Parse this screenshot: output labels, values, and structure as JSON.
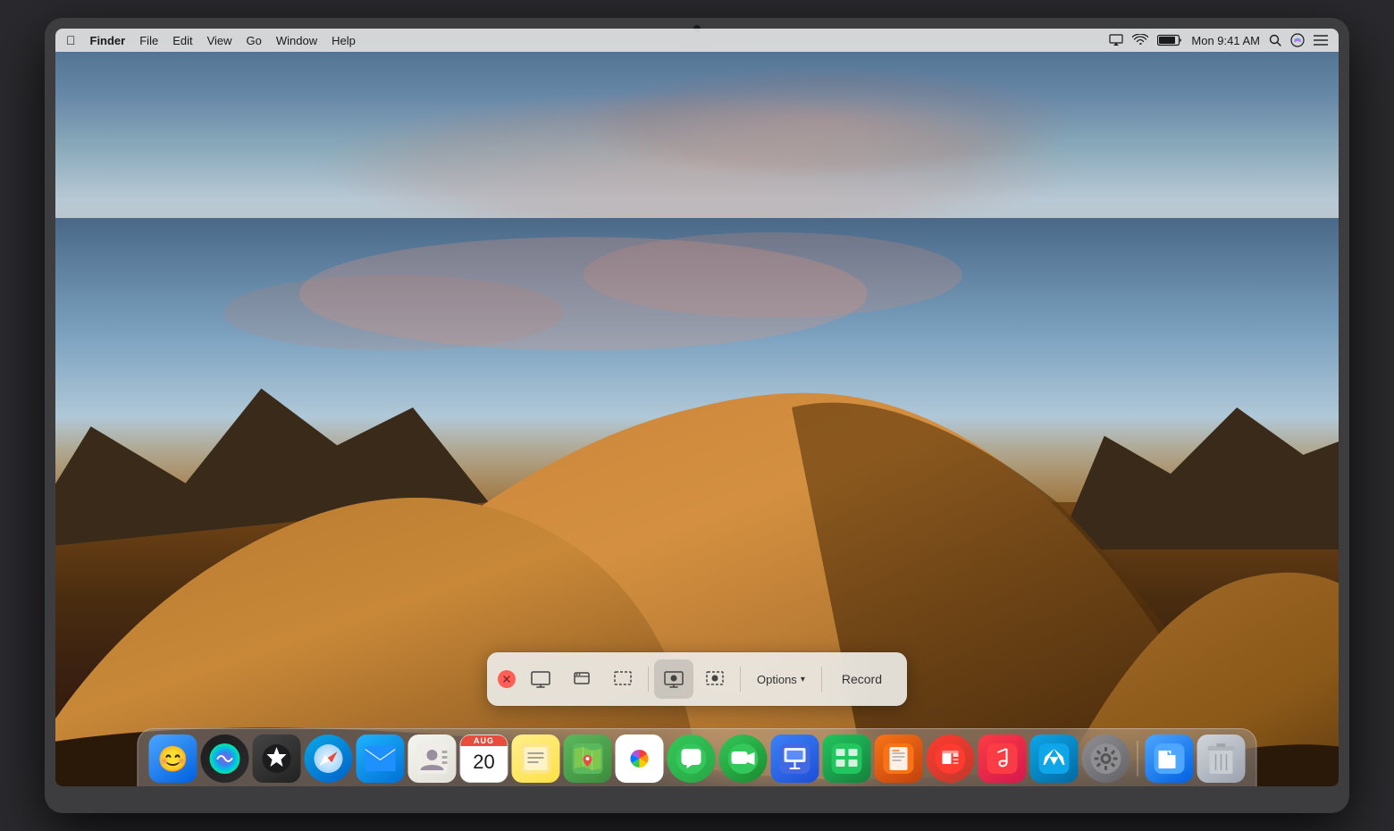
{
  "laptop": {
    "frame_color": "#3d3d3f"
  },
  "menubar": {
    "apple_symbol": "🍎",
    "finder_label": "Finder",
    "menu_items": [
      "File",
      "Edit",
      "View",
      "Go",
      "Window",
      "Help"
    ],
    "time": "Mon 9:41 AM",
    "battery_icon": "battery",
    "wifi_icon": "wifi",
    "airplay_icon": "airplay",
    "search_icon": "search",
    "siri_icon": "siri",
    "list_icon": "list"
  },
  "screenshot_toolbar": {
    "close_label": "×",
    "options_label": "Options",
    "options_chevron": "▾",
    "record_label": "Record",
    "buttons": [
      {
        "id": "capture-fullscreen",
        "tooltip": "Capture Entire Screen"
      },
      {
        "id": "capture-window",
        "tooltip": "Capture Selected Window"
      },
      {
        "id": "capture-selection",
        "tooltip": "Capture Selected Portion"
      },
      {
        "id": "record-fullscreen",
        "tooltip": "Record Entire Screen",
        "active": true
      },
      {
        "id": "record-selection",
        "tooltip": "Record Selected Portion"
      }
    ]
  },
  "dock": {
    "icons": [
      {
        "id": "finder",
        "label": "Finder",
        "emoji": "😊"
      },
      {
        "id": "siri",
        "label": "Siri",
        "emoji": "🔮"
      },
      {
        "id": "launchpad",
        "label": "Launchpad",
        "emoji": "🚀"
      },
      {
        "id": "safari",
        "label": "Safari",
        "emoji": "🧭"
      },
      {
        "id": "mail",
        "label": "Mail",
        "emoji": "✉️"
      },
      {
        "id": "contacts",
        "label": "Contacts",
        "emoji": "👤"
      },
      {
        "id": "calendar",
        "label": "Calendar",
        "day": "20",
        "month": "AUG"
      },
      {
        "id": "notes",
        "label": "Notes",
        "emoji": "📝"
      },
      {
        "id": "maps",
        "label": "Maps",
        "emoji": "🗺️"
      },
      {
        "id": "photos",
        "label": "Photos",
        "emoji": "🌸"
      },
      {
        "id": "messages",
        "label": "Messages",
        "emoji": "💬"
      },
      {
        "id": "facetime",
        "label": "FaceTime",
        "emoji": "📹"
      },
      {
        "id": "keynote",
        "label": "Keynote",
        "emoji": "📊"
      },
      {
        "id": "numbers",
        "label": "Numbers",
        "emoji": "🔢"
      },
      {
        "id": "pages",
        "label": "Pages",
        "emoji": "📄"
      },
      {
        "id": "news",
        "label": "News",
        "emoji": "📰"
      },
      {
        "id": "music",
        "label": "Music",
        "emoji": "🎵"
      },
      {
        "id": "appstore",
        "label": "App Store",
        "emoji": "🅰️"
      },
      {
        "id": "settings",
        "label": "System Preferences",
        "emoji": "⚙️"
      },
      {
        "id": "files",
        "label": "Files",
        "emoji": "📁"
      },
      {
        "id": "trash",
        "label": "Trash",
        "emoji": "🗑️"
      }
    ]
  }
}
